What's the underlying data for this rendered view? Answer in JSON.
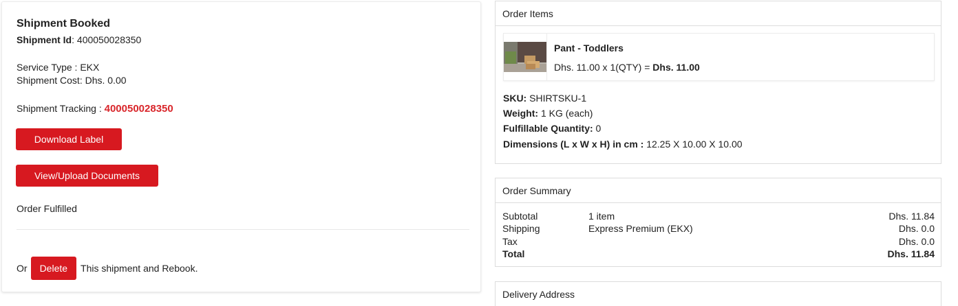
{
  "shipment": {
    "title": "Shipment Booked",
    "id_label": "Shipment Id",
    "id_value": ": 400050028350",
    "service_type": "Service Type : EKX",
    "shipment_cost": "Shipment Cost: Dhs. 0.00",
    "tracking_label": "Shipment Tracking : ",
    "tracking_number": "400050028350",
    "download_label_button": "Download Label",
    "view_upload_button": "View/Upload Documents",
    "status": "Order Fulfilled",
    "rebook_prefix": "Or",
    "delete_button": "Delete",
    "rebook_suffix": "This shipment and Rebook."
  },
  "order_items": {
    "heading": "Order Items",
    "item": {
      "name": "Pant - Toddlers",
      "price_line": "Dhs. 11.00 x 1(QTY) = ",
      "price_total": "Dhs. 11.00",
      "image_icon": "product-photo-boxes"
    },
    "sku_label": "SKU:",
    "sku_value": " SHIRTSKU-1",
    "weight_label": "Weight:",
    "weight_value": " 1 KG (each)",
    "fulfillable_label": "Fulfillable Quantity:",
    "fulfillable_value": " 0",
    "dimensions_label": "Dimensions (L x W x H) in cm :",
    "dimensions_value": " 12.25 X 10.00 X 10.00"
  },
  "order_summary": {
    "heading": "Order Summary",
    "rows": [
      {
        "label": "Subtotal",
        "detail": "1 item",
        "amount": "Dhs. 11.84"
      },
      {
        "label": "Shipping",
        "detail": "Express Premium (EKX)",
        "amount": "Dhs. 0.0"
      },
      {
        "label": "Tax",
        "detail": "",
        "amount": "Dhs. 0.0"
      },
      {
        "label": "Total",
        "detail": "",
        "amount": "Dhs. 11.84"
      }
    ]
  },
  "delivery_address": {
    "heading": "Delivery Address"
  },
  "colors": {
    "accent_red": "#d71920",
    "tracking_red": "#d9262b"
  }
}
